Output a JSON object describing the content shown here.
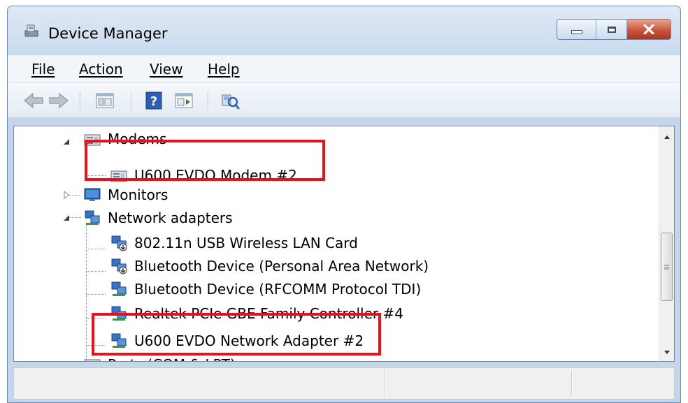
{
  "window": {
    "title": "Device Manager",
    "title_icon": "device-manager-icon"
  },
  "caption_buttons": [
    "minimize-icon",
    "maximize-icon",
    "close-icon"
  ],
  "menu": [
    "File",
    "Action",
    "View",
    "Help"
  ],
  "toolbar": [
    "back-arrow-icon",
    "forward-arrow-icon",
    "properties-icon",
    "help-icon",
    "update-driver-icon",
    "scan-hardware-icon"
  ],
  "tree": {
    "modems": "Modems",
    "modem_1": "U600 EVDO Modem #2",
    "monitors": "Monitors",
    "network_adapters": "Network adapters",
    "adapter_1": "802.11n USB Wireless LAN Card",
    "adapter_2": "Bluetooth Device (Personal Area Network)",
    "adapter_3": "Bluetooth Device (RFCOMM Protocol TDI)",
    "adapter_4": "Realtek PCIe GBE Family Controller #4",
    "adapter_5": "U600 EVDO Network Adapter #2",
    "ports": "Ports (COM & LPT)"
  },
  "colors": {
    "highlight": "#e8121c",
    "window_frame": "#c3d6ec",
    "close_button": "#c9553c"
  }
}
